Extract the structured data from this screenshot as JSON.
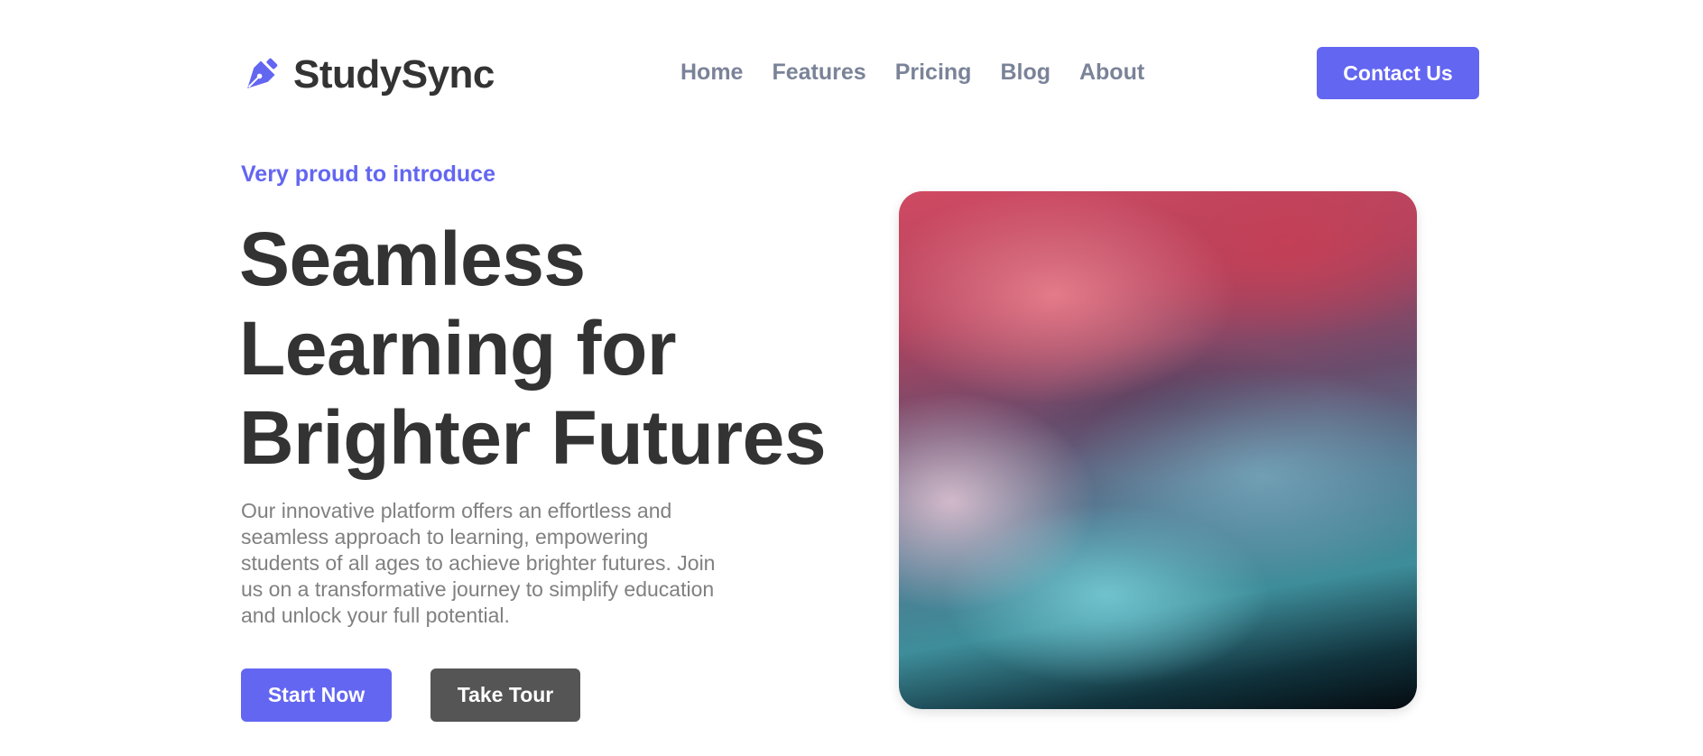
{
  "header": {
    "brand": "StudySync",
    "logo_icon": "pen-nib-icon",
    "nav": [
      {
        "label": "Home"
      },
      {
        "label": "Features"
      },
      {
        "label": "Pricing"
      },
      {
        "label": "Blog"
      },
      {
        "label": "About"
      }
    ],
    "contact_label": "Contact Us"
  },
  "hero": {
    "eyebrow": "Very proud to introduce",
    "headline": "Seamless Learning for Brighter Futures",
    "description": "Our innovative platform offers an effortless and seamless approach to learning, empowering students of all ages to achieve brighter futures. Join us on a transformative journey to simplify education and unlock your full potential.",
    "primary_button": "Start Now",
    "secondary_button": "Take Tour",
    "image_icon": "abstract-fluid-art-image"
  },
  "colors": {
    "accent": "#6366f1",
    "text_dark": "#333333",
    "nav_text": "#7a8398",
    "body_text": "#808080",
    "secondary_button": "#555555"
  }
}
